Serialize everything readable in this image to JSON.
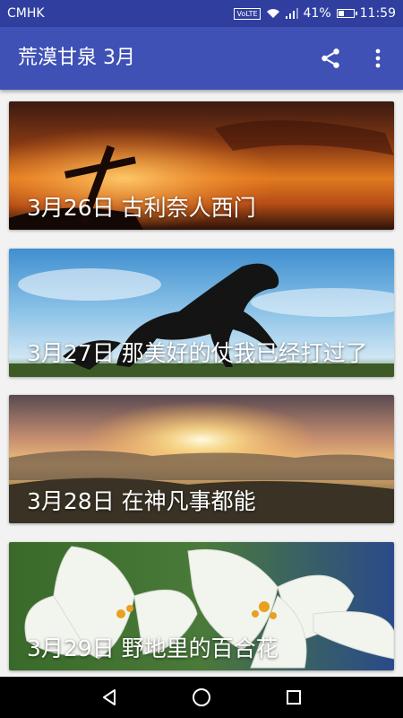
{
  "status_bar": {
    "carrier": "CMHK",
    "volte": "VoLTE",
    "battery_percent": "41%",
    "battery_level": 0.41,
    "time": "11:59"
  },
  "app_bar": {
    "title": "荒漠甘泉 3月",
    "share_icon": "share-icon",
    "more_icon": "more-vert-icon"
  },
  "cards": [
    {
      "title": "3月26日 古利奈人西门"
    },
    {
      "title": "3月27日 那美好的仗我已经打过了"
    },
    {
      "title": "3月28日 在神凡事都能"
    },
    {
      "title": "3月29日 野地里的百合花"
    }
  ],
  "nav_bar": {
    "back_icon": "back-triangle-icon",
    "home_icon": "home-circle-icon",
    "recents_icon": "recents-square-icon"
  },
  "colors": {
    "status_bar": "#303f9f",
    "app_bar": "#3f51b5",
    "background": "#f2f2f2"
  }
}
